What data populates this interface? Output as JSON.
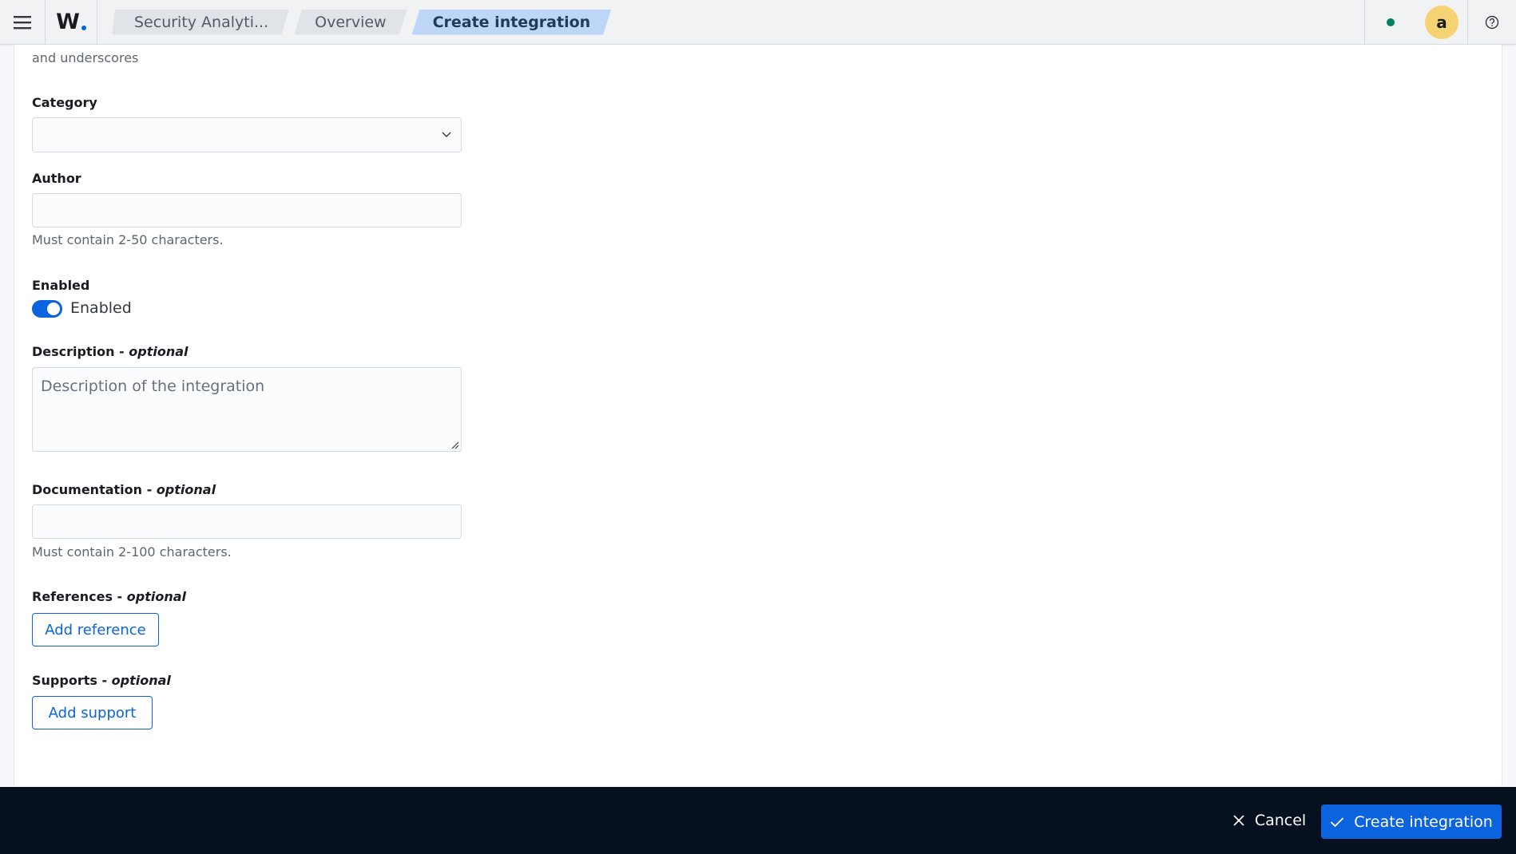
{
  "header": {
    "logo_text": "W",
    "breadcrumbs": [
      "Security Analyti...",
      "Overview",
      "Create integration"
    ],
    "avatar_letter": "a",
    "status_color": "#00805f"
  },
  "form": {
    "name_help_tail": "and underscores",
    "category": {
      "label": "Category",
      "value": ""
    },
    "author": {
      "label": "Author",
      "value": "",
      "help": "Must contain 2-50 characters."
    },
    "enabled": {
      "label": "Enabled",
      "toggle_label": "Enabled",
      "checked": true
    },
    "description": {
      "label": "Description - ",
      "optional": "optional",
      "placeholder": "Description of the integration"
    },
    "documentation": {
      "label": "Documentation - ",
      "optional": "optional",
      "value": "",
      "help": "Must contain 2-100 characters."
    },
    "references": {
      "label": "References - ",
      "optional": "optional",
      "button": "Add reference"
    },
    "supports": {
      "label": "Supports - ",
      "optional": "optional",
      "button": "Add support"
    }
  },
  "footer": {
    "cancel_label": "Cancel",
    "create_label": "Create integration"
  },
  "colors": {
    "primary": "#0b64dd",
    "footer_bg": "#07101f",
    "avatar_bg": "#f5d372"
  }
}
